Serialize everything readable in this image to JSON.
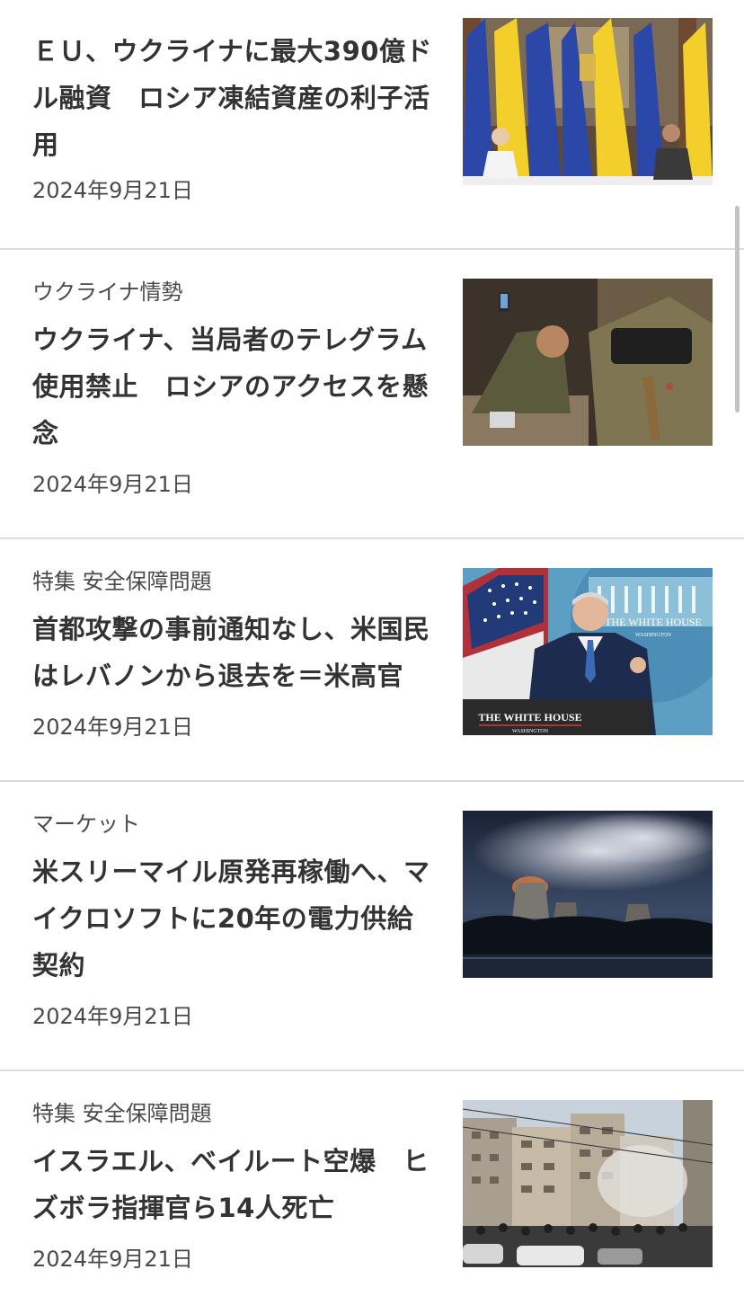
{
  "articles": [
    {
      "category": "",
      "headline": "ＥＵ、ウクライナに最大390億ドル融資　ロシア凍結資産の利子活用",
      "date": "2024年9月21日",
      "image": "eu-ukraine-press-conference-photo"
    },
    {
      "category": "ウクライナ情勢",
      "headline": "ウクライナ、当局者のテレグラム使用禁止　ロシアのアクセスを懸念",
      "date": "2024年9月21日",
      "image": "soldier-with-smartphone-photo"
    },
    {
      "category": "特集 安全保障問題",
      "headline": "首都攻撃の事前通知なし、米国民はレバノンから退去を＝米高官",
      "date": "2024年9月21日",
      "image": "white-house-briefing-photo",
      "photo_text": {
        "backdrop": "THE WHITE HOUSE",
        "backdrop_sub": "WASHINGTON",
        "podium": "THE WHITE HOUSE",
        "podium_sub": "WASHINGTON"
      }
    },
    {
      "category": "マーケット",
      "headline": "米スリーマイル原発再稼働へ、マイクロソフトに20年の電力供給契約",
      "date": "2024年9月21日",
      "image": "nuclear-plant-cooling-towers-photo"
    },
    {
      "category": "特集 安全保障問題",
      "headline": "イスラエル、ベイルート空爆　ヒズボラ指揮官ら14人死亡",
      "date": "2024年9月21日",
      "image": "beirut-strike-aftermath-photo"
    }
  ],
  "colors": {
    "headline": "#333333",
    "meta": "#4a4a4a",
    "divider": "#dcdcdc",
    "background": "#ffffff"
  }
}
